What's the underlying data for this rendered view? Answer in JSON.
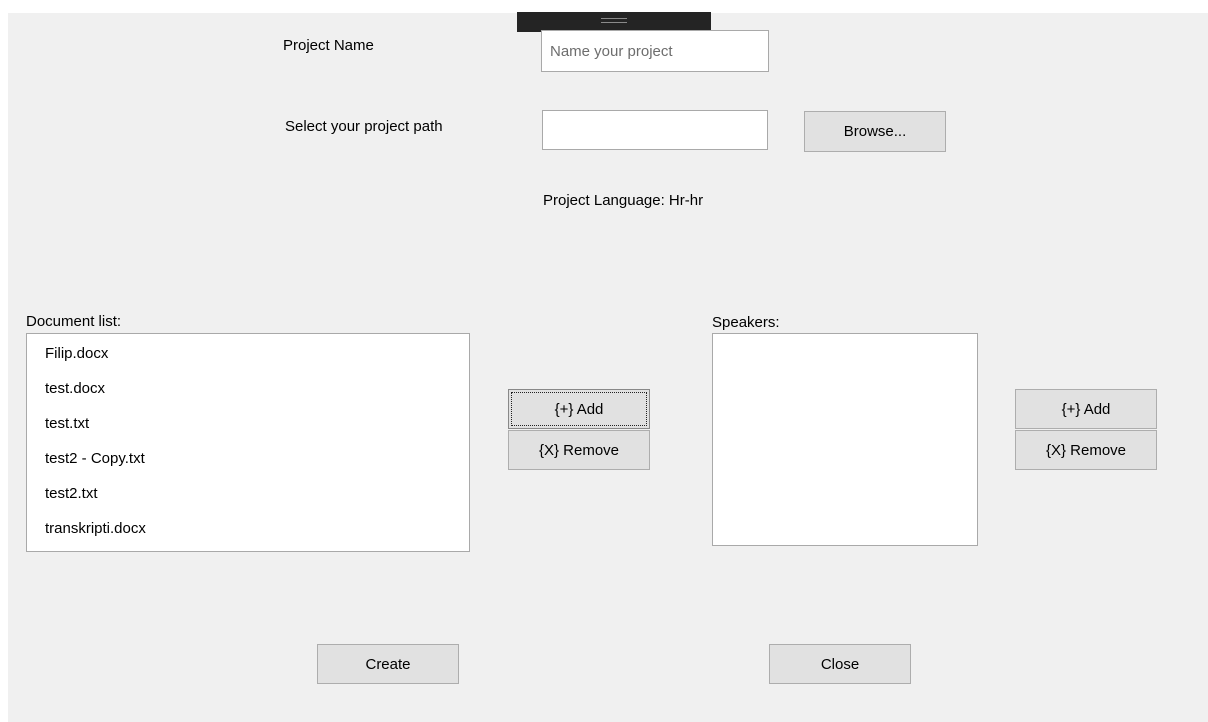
{
  "form": {
    "project_name_label": "Project Name",
    "project_name_placeholder": "Name your project",
    "project_name_value": "",
    "project_path_label": "Select your project path",
    "project_path_value": "",
    "browse_button": "Browse...",
    "project_language": "Project Language: Hr-hr"
  },
  "documents": {
    "label": "Document list:",
    "items": [
      "Filip.docx",
      "test.docx",
      "test.txt",
      "test2 - Copy.txt",
      "test2.txt",
      "transkripti.docx"
    ],
    "add_button": "{+} Add",
    "remove_button": "{X} Remove"
  },
  "speakers": {
    "label": "Speakers:",
    "items": [],
    "add_button": "{+} Add",
    "remove_button": "{X} Remove"
  },
  "footer": {
    "create_button": "Create",
    "close_button": "Close"
  }
}
